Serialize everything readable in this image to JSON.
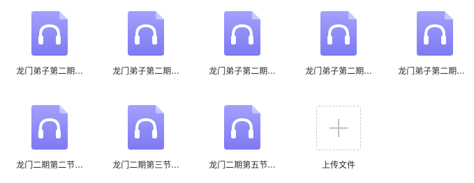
{
  "files": [
    {
      "name": "龙门弟子第二期...",
      "icon": "audio-file-icon"
    },
    {
      "name": "龙门弟子第二期...",
      "icon": "audio-file-icon"
    },
    {
      "name": "龙门弟子第二期...",
      "icon": "audio-file-icon"
    },
    {
      "name": "龙门弟子第二期...",
      "icon": "audio-file-icon"
    },
    {
      "name": "龙门弟子第二期...",
      "icon": "audio-file-icon"
    },
    {
      "name": "龙门二期第二节...",
      "icon": "audio-file-icon"
    },
    {
      "name": "龙门二期第三节...",
      "icon": "audio-file-icon"
    },
    {
      "name": "龙门二期第五节...",
      "icon": "audio-file-icon"
    }
  ],
  "upload": {
    "label": "上传文件",
    "icon": "plus-icon"
  },
  "colors": {
    "icon_gradient_top": "#a09cff",
    "icon_gradient_bottom": "#7f7cf3",
    "icon_fold": "#c7c4ff",
    "upload_border": "#c9c9c9",
    "plus": "#c0c0c0",
    "label_text": "#2b2b2b"
  }
}
